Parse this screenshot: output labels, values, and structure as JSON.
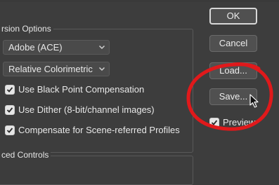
{
  "conversion_group": {
    "legend": "rsion Options"
  },
  "advanced_group": {
    "legend": "ced Controls"
  },
  "engine_select": {
    "value": "Adobe (ACE)"
  },
  "intent_select": {
    "value": "Relative Colorimetric"
  },
  "checkboxes": [
    {
      "label": "Use Black Point Compensation",
      "checked": true
    },
    {
      "label": "Use Dither (8-bit/channel images)",
      "checked": true
    },
    {
      "label": "Compensate for Scene-referred Profiles",
      "checked": true
    }
  ],
  "buttons": {
    "ok": "OK",
    "cancel": "Cancel",
    "load": "Load...",
    "save": "Save..."
  },
  "preview": {
    "label": "Preview",
    "checked": true
  },
  "annotation_color": "#e0191b"
}
